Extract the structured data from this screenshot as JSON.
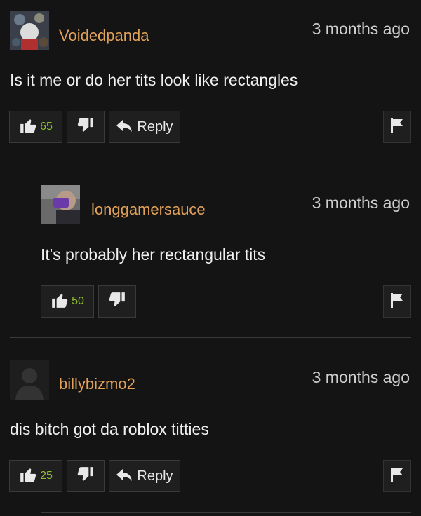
{
  "comments": [
    {
      "username": "Voidedpanda",
      "timestamp": "3 months ago",
      "text": "Is it me or do her tits look like rectangles",
      "likes": "65",
      "reply_label": "Reply"
    },
    {
      "username": "longgamersauce",
      "timestamp": "3 months ago",
      "text": "It's probably her rectangular tits",
      "likes": "50"
    },
    {
      "username": "billybizmo2",
      "timestamp": "3 months ago",
      "text": "dis bitch got da roblox titties",
      "likes": "25",
      "reply_label": "Reply"
    }
  ],
  "colors": {
    "background": "#141414",
    "username": "#e3a25a",
    "like_count": "#8fbf2f"
  },
  "icons": [
    "thumbs-up-icon",
    "thumbs-down-icon",
    "reply-arrow-icon",
    "flag-icon"
  ]
}
